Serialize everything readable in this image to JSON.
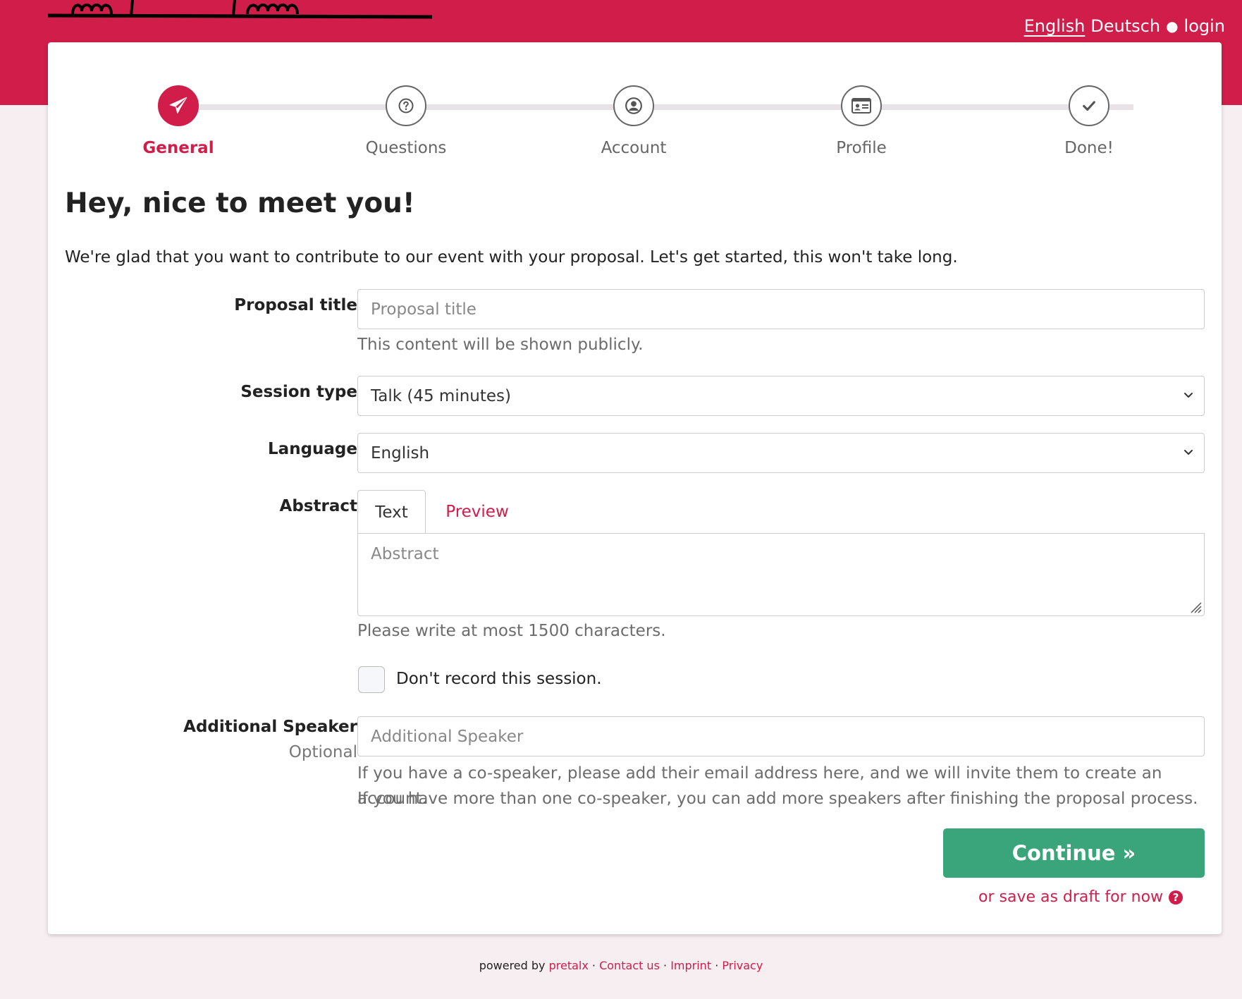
{
  "header": {
    "languages": [
      {
        "label": "English",
        "active": true
      },
      {
        "label": "Deutsch",
        "active": false
      }
    ],
    "separator": "●",
    "login_label": "login"
  },
  "stepper": {
    "steps": [
      {
        "label": "General",
        "icon": "paper-plane-icon",
        "active": true
      },
      {
        "label": "Questions",
        "icon": "question-circle-icon",
        "active": false
      },
      {
        "label": "Account",
        "icon": "user-circle-icon",
        "active": false
      },
      {
        "label": "Profile",
        "icon": "id-card-icon",
        "active": false
      },
      {
        "label": "Done!",
        "icon": "check-icon",
        "active": false
      }
    ]
  },
  "main": {
    "title": "Hey, nice to meet you!",
    "intro": "We're glad that you want to contribute to our event with your proposal. Let's get started, this won't take long."
  },
  "form": {
    "proposal_title": {
      "label": "Proposal title",
      "placeholder": "Proposal title",
      "value": "",
      "help": "This content will be shown publicly."
    },
    "session_type": {
      "label": "Session type",
      "selected": "Talk (45 minutes)"
    },
    "language": {
      "label": "Language",
      "selected": "English"
    },
    "abstract": {
      "label": "Abstract",
      "tab_text": "Text",
      "tab_preview": "Preview",
      "placeholder": "Abstract",
      "help": "Please write at most 1500 characters."
    },
    "dont_record": {
      "label": "Don't record this session.",
      "checked": false
    },
    "additional_speaker": {
      "label": "Additional Speaker",
      "sublabel": "Optional",
      "placeholder": "Additional Speaker",
      "help_line1": "If you have a co-speaker, please add their email address here, and we will invite them to create an account.",
      "help_line2": "If you have more than one co-speaker, you can add more speakers after finishing the proposal process."
    },
    "continue_label": "Continue »",
    "draft_label": "or save as draft for now"
  },
  "footer": {
    "powered_by": "powered by",
    "pretalx": "pretalx",
    "contact": "Contact us",
    "imprint": "Imprint",
    "privacy": "Privacy",
    "sep": "·"
  },
  "colors": {
    "brand": "#d11d4a",
    "success": "#3aa57a",
    "background": "#f7eef1"
  }
}
